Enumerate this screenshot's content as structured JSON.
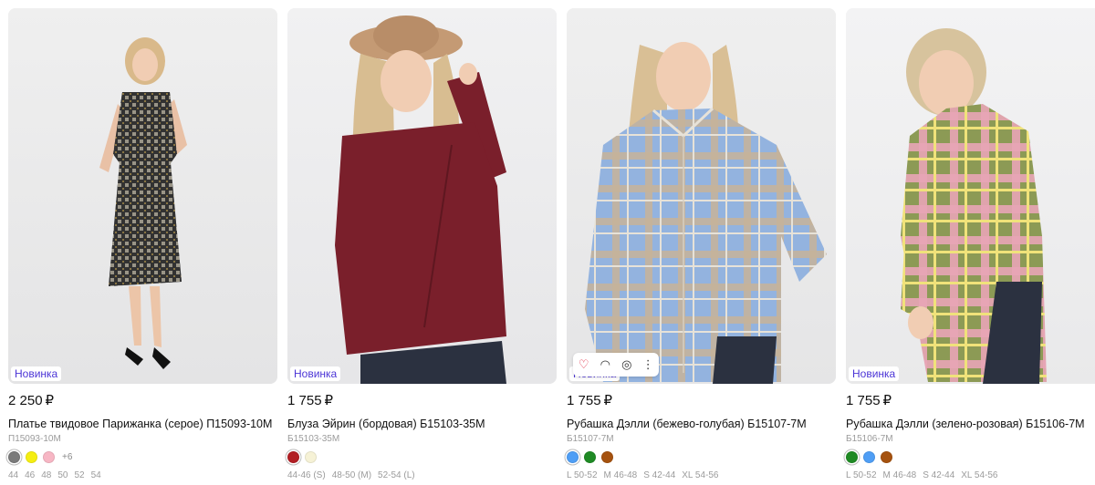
{
  "products": [
    {
      "badge": "Новинка",
      "price": "2 250",
      "currency": "₽",
      "title": "Платье твидовое Парижанка (серое) П15093-10М",
      "sku": "П15093-10М",
      "colors": [
        "#7a7a7a",
        "#f5ee12",
        "#f7b6c4"
      ],
      "more_colors": "+6",
      "sizes": [
        "44",
        "46",
        "48",
        "50",
        "52",
        "54"
      ],
      "photo_bg": "#e9e9ea",
      "garment_color": "#2a2a2a"
    },
    {
      "badge": "Новинка",
      "price": "1 755",
      "currency": "₽",
      "title": "Блуза Эйрин (бордовая) Б15103-35М",
      "sku": "Б15103-35М",
      "colors": [
        "#b21f24",
        "#f6f2d6"
      ],
      "more_colors": "",
      "sizes": [
        "44-46 (S)",
        "48-50 (M)",
        "52-54 (L)"
      ],
      "photo_bg": "#eeeeef",
      "garment_color": "#7a1f2b"
    },
    {
      "badge": "Новинка",
      "price": "1 755",
      "currency": "₽",
      "title": "Рубашка Дэлли (бежево-голубая) Б15107-7М",
      "sku": "Б15107-7М",
      "colors": [
        "#4f9ef5",
        "#1f8a24",
        "#a5520f"
      ],
      "more_colors": "",
      "sizes": [
        "L 50-52",
        "M 46-48",
        "S 42-44",
        "XL 54-56"
      ],
      "photo_bg": "#ededee",
      "garment_color": "#8fb0d9"
    },
    {
      "badge": "Новинка",
      "price": "1 755",
      "currency": "₽",
      "title": "Рубашка Дэлли (зелено-розовая) Б15106-7М",
      "sku": "Б15106-7М",
      "colors": [
        "#1f8a24",
        "#4f9ef5",
        "#a5520f"
      ],
      "more_colors": "",
      "sizes": [
        "L 50-52",
        "M 46-48",
        "S 42-44",
        "XL 54-56"
      ],
      "photo_bg": "#f1f1f2",
      "garment_color": "#8a9a4e"
    }
  ],
  "hover_actions": {
    "icons": [
      "heart-icon",
      "eye-icon",
      "camera-icon",
      "more-vertical-icon"
    ]
  }
}
